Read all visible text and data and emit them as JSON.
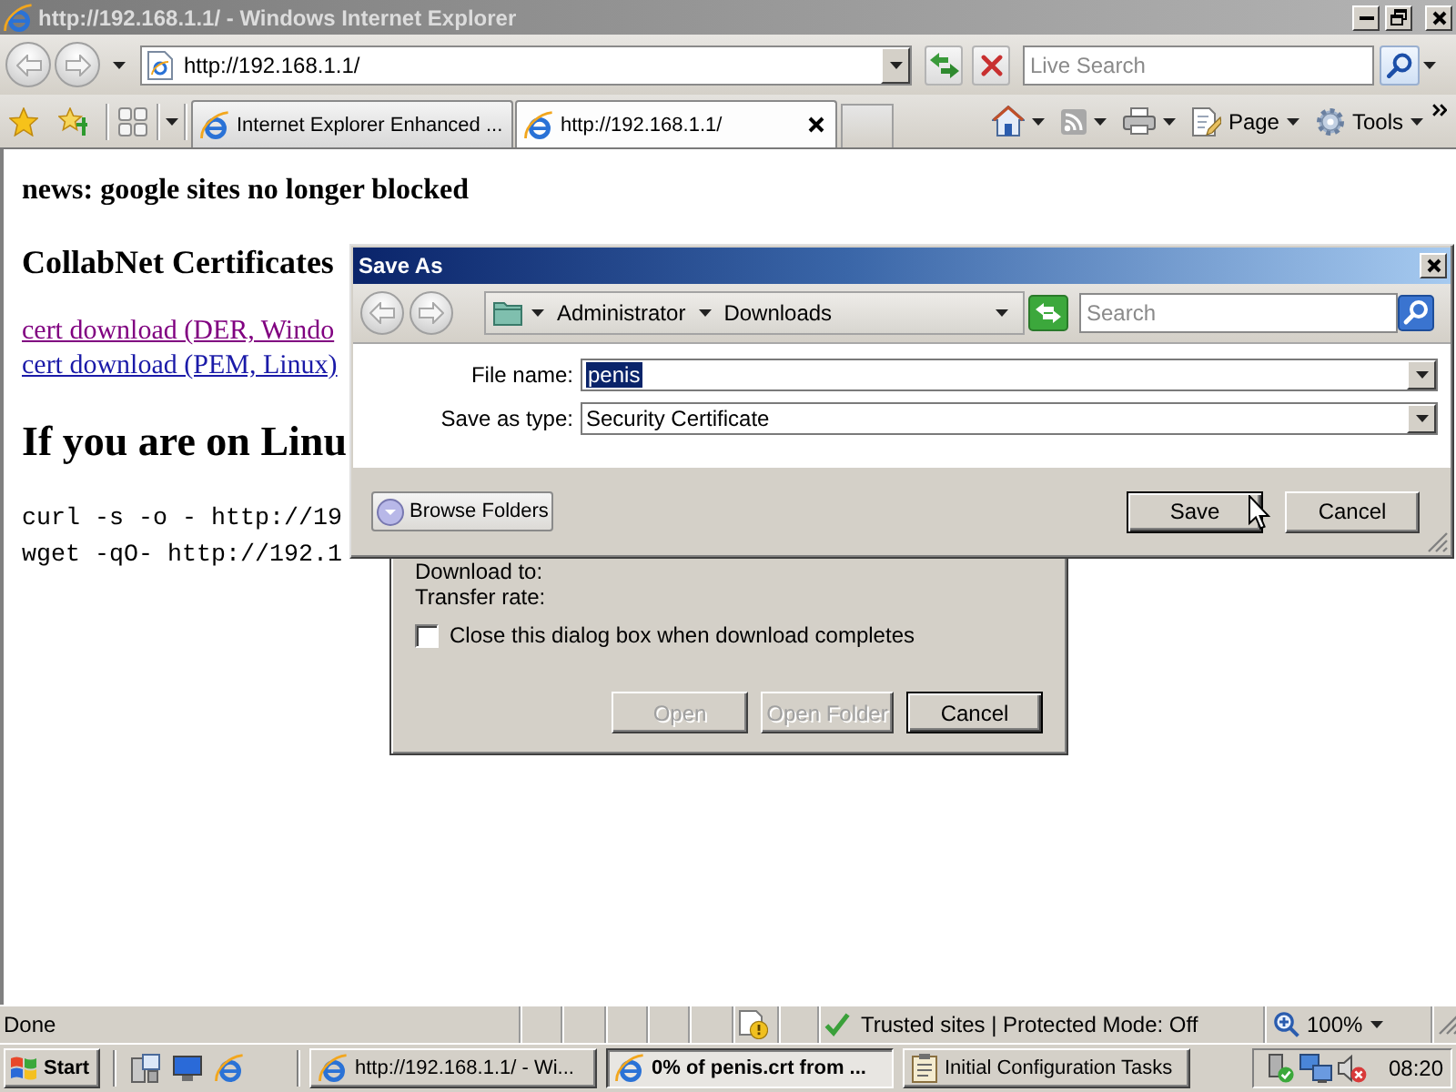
{
  "window": {
    "title": "http://192.168.1.1/ - Windows Internet Explorer"
  },
  "address_bar": {
    "url": "http://192.168.1.1/"
  },
  "search": {
    "placeholder": "Live Search"
  },
  "tabs": [
    {
      "label": "Internet Explorer Enhanced ...",
      "selected": false
    },
    {
      "label": "http://192.168.1.1/",
      "selected": true
    }
  ],
  "command_bar": {
    "page": "Page",
    "tools": "Tools"
  },
  "page": {
    "news": "news: google sites no longer blocked",
    "heading": "CollabNet Certificates",
    "links": [
      {
        "text": "cert download (DER, Windo",
        "visited": true
      },
      {
        "text": "cert download (PEM, Linux)",
        "visited": false
      }
    ],
    "section_heading": "If you are on Linu",
    "commands": [
      "curl -s -o - http://19",
      "wget -qO- http://192.1"
    ]
  },
  "download_dialog": {
    "fields": [
      "Download to:",
      "Transfer rate:"
    ],
    "close_when_done": {
      "label": "Close this dialog box when download completes",
      "checked": false
    },
    "buttons": [
      {
        "label": "Open",
        "disabled": true,
        "default": false
      },
      {
        "label": "Open Folder",
        "disabled": true,
        "default": false
      },
      {
        "label": "Cancel",
        "disabled": false,
        "default": true
      }
    ]
  },
  "save_dialog": {
    "title": "Save As",
    "path": [
      "Administrator",
      "Downloads"
    ],
    "search_placeholder": "Search",
    "file_name": {
      "label": "File name:",
      "value": "penis",
      "selected": true
    },
    "save_as_type": {
      "label": "Save as type:",
      "value": "Security Certificate"
    },
    "browse_folders": "Browse Folders",
    "buttons": [
      {
        "label": "Save",
        "default": true
      },
      {
        "label": "Cancel",
        "default": false
      }
    ]
  },
  "status_bar": {
    "text": "Done",
    "zone": "Trusted sites | Protected Mode: Off",
    "zoom": "100%"
  },
  "taskbar": {
    "start": "Start",
    "tasks": [
      {
        "label": "http://192.168.1.1/ - Wi...",
        "kind": "browser",
        "selected": false
      },
      {
        "label": "0% of penis.crt from ...",
        "kind": "browser",
        "selected": true
      },
      {
        "label": "Initial Configuration Tasks",
        "kind": "tasks",
        "selected": false
      }
    ],
    "clock": "08:20"
  }
}
